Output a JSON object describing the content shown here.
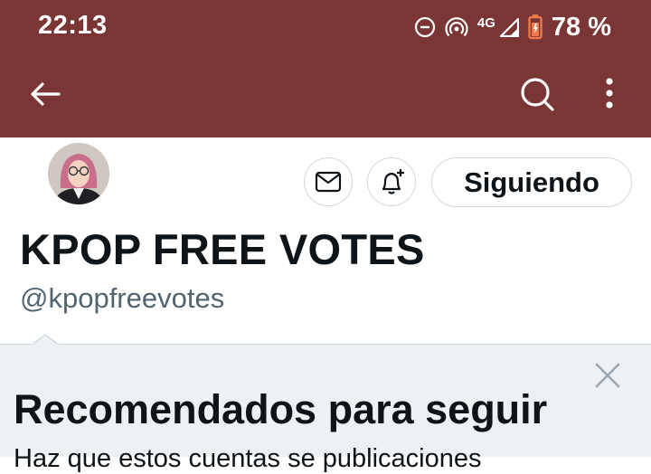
{
  "status_bar": {
    "time": "22:13",
    "network": "4G",
    "battery": "78 %",
    "icons": [
      "do-not-disturb-icon",
      "hotspot-icon",
      "signal-icon",
      "battery-icon"
    ]
  },
  "toolbar": {
    "back_icon": "arrow-left-icon",
    "search_icon": "search-icon",
    "more_icon": "more-vertical-icon",
    "background_color": "#7a3535"
  },
  "profile": {
    "follow_label": "Siguiendo",
    "message_icon": "envelope-icon",
    "notify_icon": "bell-plus-icon",
    "display_name": "KPOP FREE VOTES",
    "handle": "@kpopfreevotes"
  },
  "recommendations": {
    "title": "Recomendados para seguir",
    "close_icon": "close-icon",
    "subtitle": "Haz que estos cuentas se publicaciones"
  }
}
